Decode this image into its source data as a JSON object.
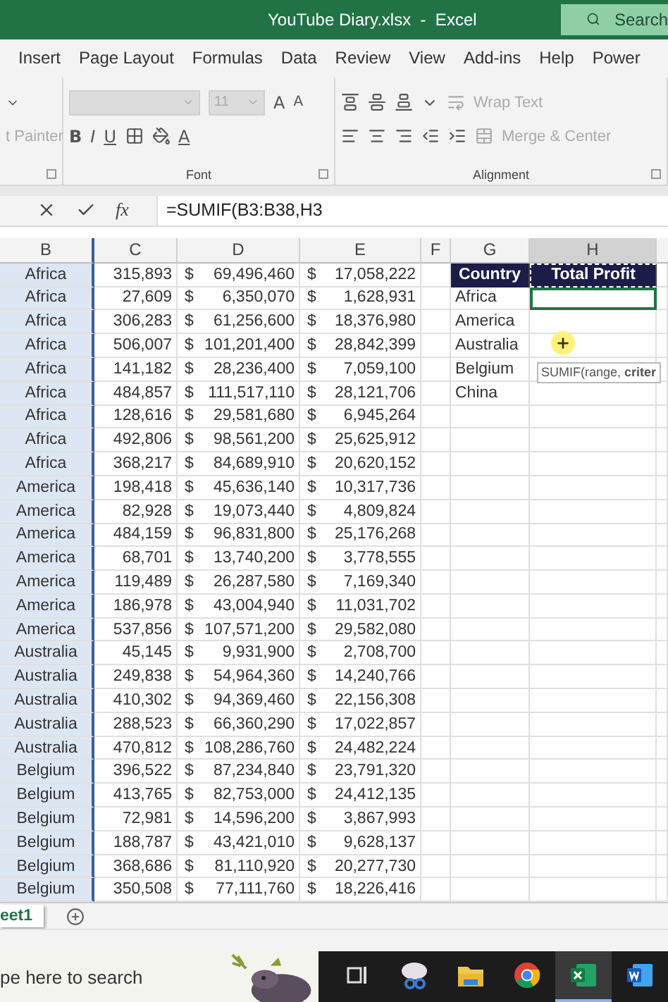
{
  "window": {
    "title": "YouTube Diary.xlsx  -  Excel",
    "search": "Search"
  },
  "menu": [
    "Insert",
    "Page Layout",
    "Formulas",
    "Data",
    "Review",
    "View",
    "Add-ins",
    "Help",
    "Power"
  ],
  "ribbon": {
    "clipboard": {
      "painter": "t Painter"
    },
    "font": {
      "size": "11",
      "grow": "A",
      "shrink": "A",
      "bold": "B",
      "italic": "I",
      "underline": "U",
      "font_color_button": "A",
      "label": "Font"
    },
    "alignment": {
      "wrap": "Wrap Text",
      "merge": "Merge & Center",
      "label": "Alignment"
    }
  },
  "formula_bar": {
    "fx": "fx",
    "formula": "=SUMIF(B3:B38,H3"
  },
  "columns": [
    {
      "label": "B",
      "referenced": true,
      "selected": false
    },
    {
      "label": "C",
      "referenced": false,
      "selected": false
    },
    {
      "label": "D",
      "referenced": false,
      "selected": false
    },
    {
      "label": "E",
      "referenced": false,
      "selected": false
    },
    {
      "label": "F",
      "referenced": false,
      "selected": false
    },
    {
      "label": "G",
      "referenced": false,
      "selected": false
    },
    {
      "label": "H",
      "referenced": false,
      "selected": true
    }
  ],
  "rows": [
    {
      "cells": [
        "Africa",
        "315,893",
        "$",
        "69,496,460",
        "$",
        "17,058,222"
      ]
    },
    {
      "cells": [
        "Africa",
        "27,609",
        "$",
        "6,350,070",
        "$",
        "1,628,931"
      ]
    },
    {
      "cells": [
        "Africa",
        "306,283",
        "$",
        "61,256,600",
        "$",
        "18,376,980"
      ]
    },
    {
      "cells": [
        "Africa",
        "506,007",
        "$",
        "101,201,400",
        "$",
        "28,842,399"
      ]
    },
    {
      "cells": [
        "Africa",
        "141,182",
        "$",
        "28,236,400",
        "$",
        "7,059,100"
      ]
    },
    {
      "cells": [
        "Africa",
        "484,857",
        "$",
        "111,517,110",
        "$",
        "28,121,706"
      ]
    },
    {
      "cells": [
        "Africa",
        "128,616",
        "$",
        "29,581,680",
        "$",
        "6,945,264"
      ]
    },
    {
      "cells": [
        "Africa",
        "492,806",
        "$",
        "98,561,200",
        "$",
        "25,625,912"
      ]
    },
    {
      "cells": [
        "Africa",
        "368,217",
        "$",
        "84,689,910",
        "$",
        "20,620,152"
      ]
    },
    {
      "cells": [
        "America",
        "198,418",
        "$",
        "45,636,140",
        "$",
        "10,317,736"
      ]
    },
    {
      "cells": [
        "America",
        "82,928",
        "$",
        "19,073,440",
        "$",
        "4,809,824"
      ]
    },
    {
      "cells": [
        "America",
        "484,159",
        "$",
        "96,831,800",
        "$",
        "25,176,268"
      ]
    },
    {
      "cells": [
        "America",
        "68,701",
        "$",
        "13,740,200",
        "$",
        "3,778,555"
      ]
    },
    {
      "cells": [
        "America",
        "119,489",
        "$",
        "26,287,580",
        "$",
        "7,169,340"
      ]
    },
    {
      "cells": [
        "America",
        "186,978",
        "$",
        "43,004,940",
        "$",
        "11,031,702"
      ]
    },
    {
      "cells": [
        "America",
        "537,856",
        "$",
        "107,571,200",
        "$",
        "29,582,080"
      ]
    },
    {
      "cells": [
        "Australia",
        "45,145",
        "$",
        "9,931,900",
        "$",
        "2,708,700"
      ]
    },
    {
      "cells": [
        "Australia",
        "249,838",
        "$",
        "54,964,360",
        "$",
        "14,240,766"
      ]
    },
    {
      "cells": [
        "Australia",
        "410,302",
        "$",
        "94,369,460",
        "$",
        "22,156,308"
      ]
    },
    {
      "cells": [
        "Australia",
        "288,523",
        "$",
        "66,360,290",
        "$",
        "17,022,857"
      ]
    },
    {
      "cells": [
        "Australia",
        "470,812",
        "$",
        "108,286,760",
        "$",
        "24,482,224"
      ]
    },
    {
      "cells": [
        "Belgium",
        "396,522",
        "$",
        "87,234,840",
        "$",
        "23,791,320"
      ]
    },
    {
      "cells": [
        "Belgium",
        "413,765",
        "$",
        "82,753,000",
        "$",
        "24,412,135"
      ]
    },
    {
      "cells": [
        "Belgium",
        "72,981",
        "$",
        "14,596,200",
        "$",
        "3,867,993"
      ]
    },
    {
      "cells": [
        "Belgium",
        "188,787",
        "$",
        "43,421,010",
        "$",
        "9,628,137"
      ]
    },
    {
      "cells": [
        "Belgium",
        "368,686",
        "$",
        "81,110,920",
        "$",
        "20,277,730"
      ]
    },
    {
      "cells": [
        "Belgium",
        "350,508",
        "$",
        "77,111,760",
        "$",
        "18,226,416"
      ]
    }
  ],
  "lookup": {
    "headers": [
      "Country",
      "Total Profit"
    ],
    "rows": [
      {
        "country": "Africa",
        "selected": true
      },
      {
        "country": "America",
        "selected": false
      },
      {
        "country": "Australia",
        "selected": false
      },
      {
        "country": "Belgium",
        "selected": false
      },
      {
        "country": "China",
        "selected": false
      }
    ]
  },
  "tooltip": "SUMIF(range, **criter**",
  "sheets": [
    {
      "label": "eet1",
      "selected": true
    }
  ],
  "taskbar": {
    "search": "pe here to search",
    "apps": [
      {
        "kind": "taskview",
        "selected": false
      },
      {
        "kind": "snip",
        "selected": false
      },
      {
        "kind": "folder",
        "selected": false
      },
      {
        "kind": "chrome",
        "selected": false
      },
      {
        "kind": "excel",
        "selected": true
      },
      {
        "kind": "word",
        "selected": false
      }
    ]
  }
}
